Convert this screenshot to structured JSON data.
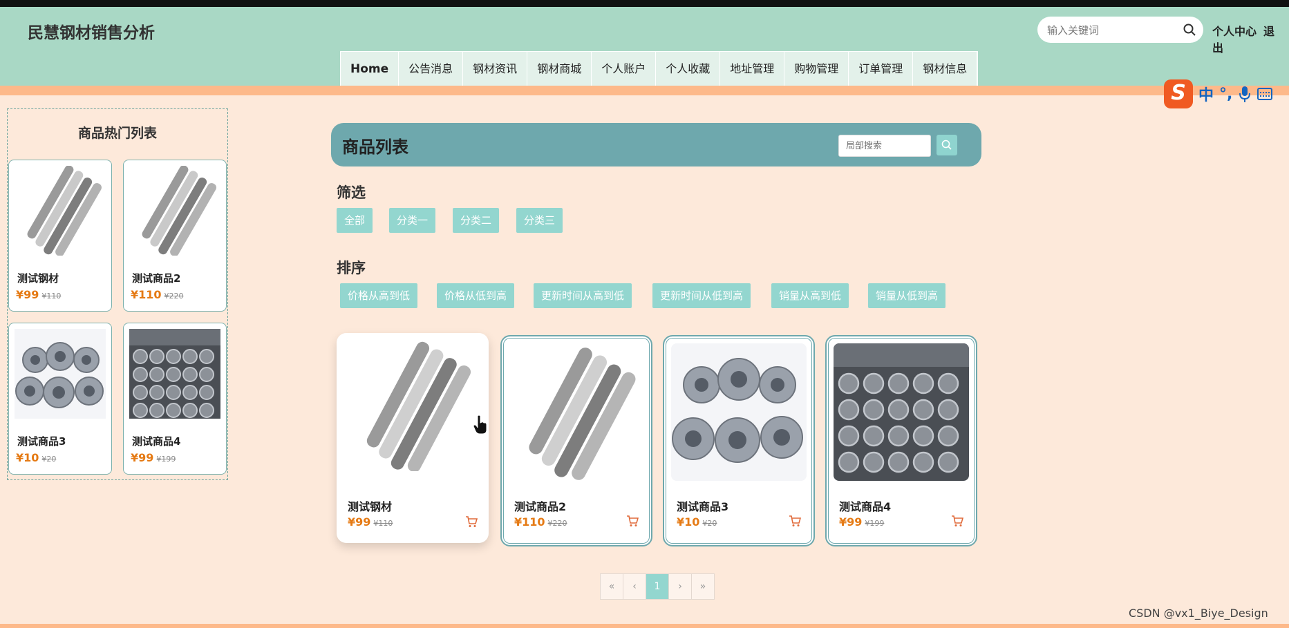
{
  "header": {
    "brand": "民慧钢材销售分析",
    "search_placeholder": "输入关键词",
    "user_center": "个人中心",
    "logout": "退出"
  },
  "nav": [
    {
      "label": "Home"
    },
    {
      "label": "公告消息"
    },
    {
      "label": "钢材资讯"
    },
    {
      "label": "钢材商城"
    },
    {
      "label": "个人账户"
    },
    {
      "label": "个人收藏"
    },
    {
      "label": "地址管理"
    },
    {
      "label": "购物管理"
    },
    {
      "label": "订单管理"
    },
    {
      "label": "钢材信息"
    }
  ],
  "ime": {
    "logo": "S",
    "lang": "中",
    "punct": "°,"
  },
  "hot": {
    "title": "商品热门列表",
    "items": [
      {
        "name": "测试钢材",
        "price": "¥99",
        "old": "¥110",
        "image": "steel-bars"
      },
      {
        "name": "测试商品2",
        "price": "¥110",
        "old": "¥220",
        "image": "steel-bars"
      },
      {
        "name": "测试商品3",
        "price": "¥10",
        "old": "¥20",
        "image": "steel-coils"
      },
      {
        "name": "测试商品4",
        "price": "¥99",
        "old": "¥199",
        "image": "steel-pipes"
      }
    ]
  },
  "list": {
    "title": "商品列表",
    "search_placeholder": "局部搜索"
  },
  "filter": {
    "label": "筛选",
    "options": [
      "全部",
      "分类一",
      "分类二",
      "分类三"
    ]
  },
  "sort": {
    "label": "排序",
    "options": [
      "价格从高到低",
      "价格从低到高",
      "更新时间从高到低",
      "更新时间从低到高",
      "销量从高到低",
      "销量从低到高"
    ]
  },
  "products": [
    {
      "name": "测试钢材",
      "price": "¥99",
      "old": "¥110",
      "image": "steel-bars"
    },
    {
      "name": "测试商品2",
      "price": "¥110",
      "old": "¥220",
      "image": "steel-bars"
    },
    {
      "name": "测试商品3",
      "price": "¥10",
      "old": "¥20",
      "image": "steel-coils"
    },
    {
      "name": "测试商品4",
      "price": "¥99",
      "old": "¥199",
      "image": "steel-pipes"
    }
  ],
  "pager": {
    "first": "«",
    "prev": "‹",
    "current": "1",
    "next": "›",
    "last": "»"
  },
  "watermark": "CSDN @vx1_Biye_Design"
}
